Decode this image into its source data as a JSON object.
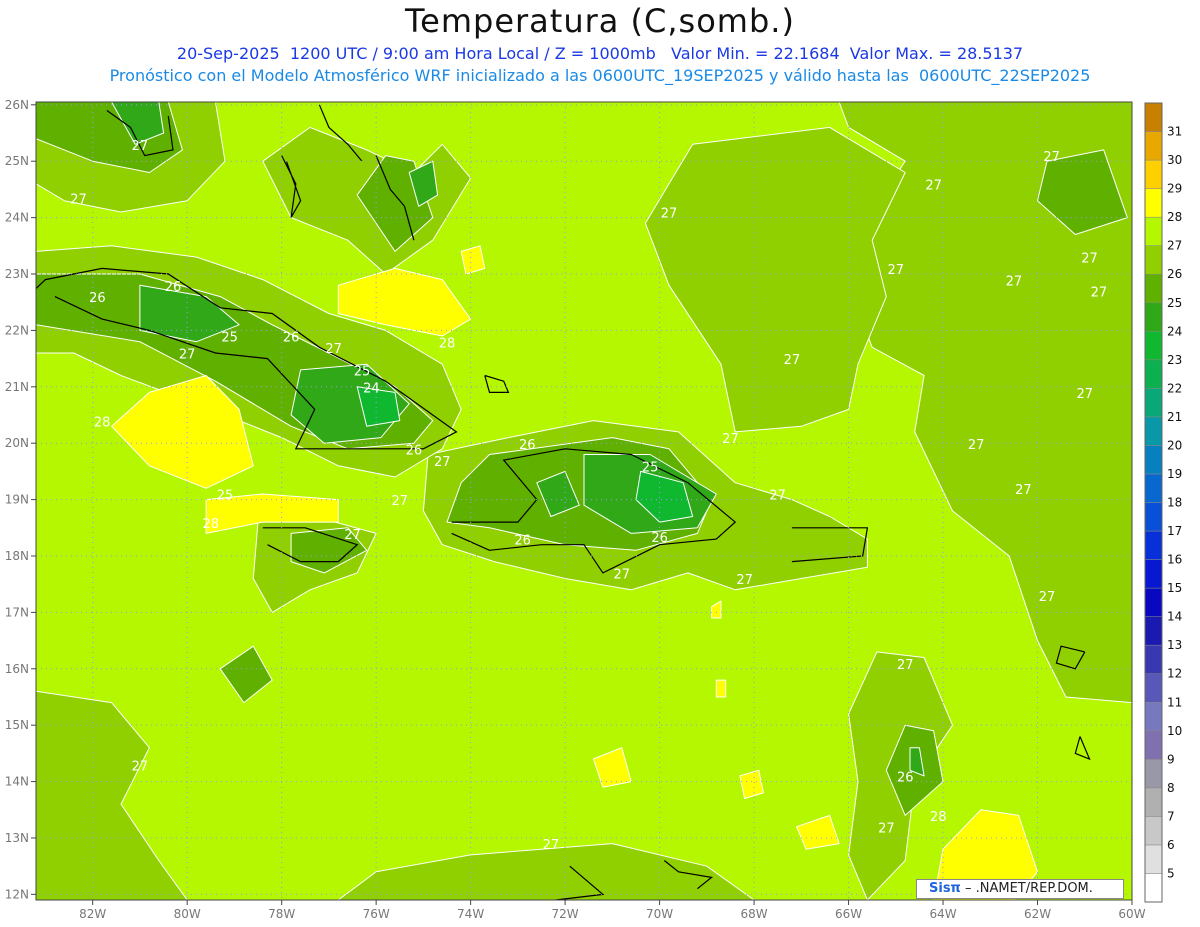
{
  "title": "Temperatura (C,somb.)",
  "subtitle_line1": "20-Sep-2025  1200 UTC / 9:00 am Hora Local / Z = 1000mb   Valor Min. = 22.1684  Valor Max. = 28.5137",
  "subtitle_line2": "Pronóstico con el Modelo Atmosférico WRF inicializado a las 0600UTC_19SEP2025 y válido hasta las  0600UTC_22SEP2025",
  "credit": {
    "brand": "Sisπ",
    "text": " –  .NAMET/REP.DOM."
  },
  "map": {
    "lon_labels": [
      "82W",
      "80W",
      "78W",
      "76W",
      "74W",
      "72W",
      "70W",
      "68W",
      "66W",
      "64W",
      "62W",
      "60W"
    ],
    "lat_labels": [
      "12N",
      "13N",
      "14N",
      "15N",
      "16N",
      "17N",
      "18N",
      "19N",
      "20N",
      "21N",
      "22N",
      "23N",
      "24N",
      "25N",
      "26N"
    ],
    "lon_range": [
      -83.2,
      -60
    ],
    "lat_range": [
      11.9,
      26.05
    ],
    "colorbar": {
      "labels": [
        "5",
        "6",
        "7",
        "8",
        "9",
        "10",
        "11",
        "12",
        "13",
        "14",
        "15",
        "16",
        "17",
        "18",
        "19",
        "20",
        "21",
        "22",
        "23",
        "24",
        "25",
        "26",
        "27",
        "28",
        "29",
        "30",
        "31"
      ],
      "colors": [
        "#ffffff",
        "#e0e0e0",
        "#c8c8c8",
        "#b0b0b0",
        "#9898a8",
        "#8070b0",
        "#7878c0",
        "#5858b8",
        "#3838b0",
        "#1a1ab0",
        "#0808c0",
        "#0818d0",
        "#0830d8",
        "#0850d8",
        "#0868d0",
        "#0880c0",
        "#0898a8",
        "#08a878",
        "#0cb050",
        "#10b830",
        "#30a818",
        "#60b000",
        "#90d000",
        "#b4f700",
        "#ffff00",
        "#ffd000",
        "#e8a800",
        "#c88000"
      ],
      "top_color": "#c88000"
    },
    "contour_labels": [
      {
        "t": "27",
        "lon": -82.3,
        "lat": 24.25
      },
      {
        "t": "27",
        "lon": -81.0,
        "lat": 25.2
      },
      {
        "t": "26",
        "lon": -81.9,
        "lat": 22.5
      },
      {
        "t": "26",
        "lon": -80.3,
        "lat": 22.7
      },
      {
        "t": "25",
        "lon": -79.1,
        "lat": 21.8
      },
      {
        "t": "27",
        "lon": -80.0,
        "lat": 21.5
      },
      {
        "t": "26",
        "lon": -77.8,
        "lat": 21.8
      },
      {
        "t": "27",
        "lon": -76.9,
        "lat": 21.6
      },
      {
        "t": "25",
        "lon": -76.3,
        "lat": 21.2
      },
      {
        "t": "24",
        "lon": -76.1,
        "lat": 20.9
      },
      {
        "t": "28",
        "lon": -81.8,
        "lat": 20.3
      },
      {
        "t": "28",
        "lon": -74.5,
        "lat": 21.7
      },
      {
        "t": "25",
        "lon": -79.2,
        "lat": 19.0
      },
      {
        "t": "28",
        "lon": -79.5,
        "lat": 18.5
      },
      {
        "t": "27",
        "lon": -76.5,
        "lat": 18.3
      },
      {
        "t": "27",
        "lon": -75.5,
        "lat": 18.9
      },
      {
        "t": "27",
        "lon": -74.6,
        "lat": 19.6
      },
      {
        "t": "26",
        "lon": -75.2,
        "lat": 19.8
      },
      {
        "t": "26",
        "lon": -72.8,
        "lat": 19.9
      },
      {
        "t": "25",
        "lon": -70.2,
        "lat": 19.5
      },
      {
        "t": "26",
        "lon": -72.9,
        "lat": 18.2
      },
      {
        "t": "27",
        "lon": -70.8,
        "lat": 17.6
      },
      {
        "t": "26",
        "lon": -70.0,
        "lat": 18.25
      },
      {
        "t": "27",
        "lon": -68.5,
        "lat": 20.0
      },
      {
        "t": "27",
        "lon": -67.5,
        "lat": 19.0
      },
      {
        "t": "27",
        "lon": -68.2,
        "lat": 17.5
      },
      {
        "t": "27",
        "lon": -67.2,
        "lat": 21.4
      },
      {
        "t": "27",
        "lon": -69.8,
        "lat": 24.0
      },
      {
        "t": "27",
        "lon": -65.0,
        "lat": 23.0
      },
      {
        "t": "27",
        "lon": -64.2,
        "lat": 24.5
      },
      {
        "t": "27",
        "lon": -61.7,
        "lat": 25.0
      },
      {
        "t": "27",
        "lon": -60.9,
        "lat": 23.2
      },
      {
        "t": "27",
        "lon": -62.5,
        "lat": 22.8
      },
      {
        "t": "27",
        "lon": -61.0,
        "lat": 20.8
      },
      {
        "t": "27",
        "lon": -63.3,
        "lat": 19.9
      },
      {
        "t": "27",
        "lon": -62.3,
        "lat": 19.1
      },
      {
        "t": "27",
        "lon": -60.7,
        "lat": 22.6
      },
      {
        "t": "27",
        "lon": -61.8,
        "lat": 17.2
      },
      {
        "t": "27",
        "lon": -64.8,
        "lat": 16.0
      },
      {
        "t": "26",
        "lon": -64.8,
        "lat": 14.0
      },
      {
        "t": "27",
        "lon": -65.2,
        "lat": 13.1
      },
      {
        "t": "28",
        "lon": -64.1,
        "lat": 13.3
      },
      {
        "t": "27",
        "lon": -72.3,
        "lat": 12.8
      },
      {
        "t": "27",
        "lon": -81.0,
        "lat": 14.2
      }
    ]
  }
}
